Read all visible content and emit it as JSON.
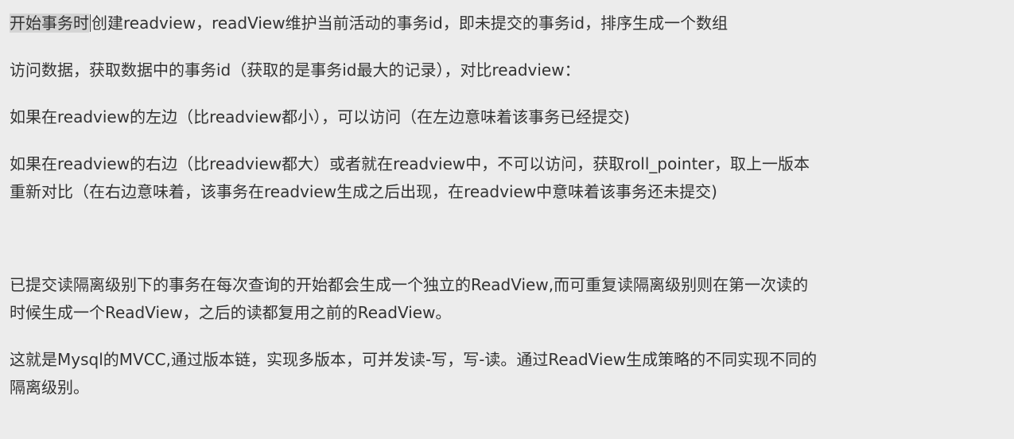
{
  "paragraphs": [
    {
      "highlight": "开始事务时",
      "text": "创建readview，readView维护当前活动的事务id，即未提交的事务id，排序生成一个数组"
    },
    {
      "text": "访问数据，获取数据中的事务id（获取的是事务id最大的记录），对比readview："
    },
    {
      "text": "如果在readview的左边（比readview都小），可以访问（在左边意味着该事务已经提交)"
    },
    {
      "line1": "如果在readview的右边（比readview都大）或者就在readview中，不可以访问，获取roll_pointer，取上一版本",
      "line2": "重新对比（在右边意味着，该事务在readview生成之后出现，在readview中意味着该事务还未提交)"
    },
    {
      "line1": "已提交读隔离级别下的事务在每次查询的开始都会生成一个独立的ReadView,而可重复读隔离级别则在第一次读的",
      "line2": "时候生成一个ReadView，之后的读都复用之前的ReadView。"
    },
    {
      "line1": "这就是Mysql的MVCC,通过版本链，实现多版本，可并发读-写，写-读。通过ReadView生成策略的不同实现不同的",
      "line2": "隔离级别。"
    }
  ]
}
